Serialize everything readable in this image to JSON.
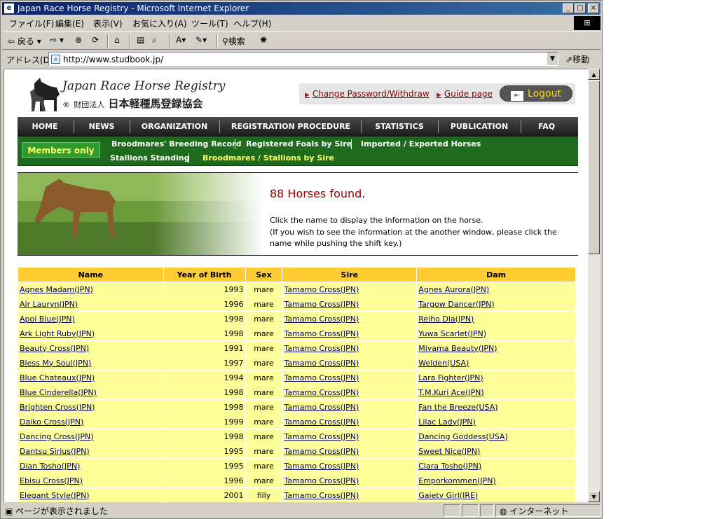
{
  "window": {
    "title": "Japan Race Horse Registry - Microsoft Internet Explorer",
    "controls": [
      "_",
      "□",
      "×"
    ]
  },
  "menu": [
    "ファイル(F)",
    "編集(E)",
    "表示(V)",
    "お気に入り(A)",
    "ツール(T)",
    "ヘルプ(H)"
  ],
  "toolbar": {
    "back": "戻る",
    "search": "検索"
  },
  "address": {
    "label": "アドレス(D)",
    "url": "http://www.studbook.jp/",
    "go": "移動"
  },
  "status": {
    "text": "ページが表示されました",
    "zone": "インターネット"
  },
  "site": {
    "logo_en": "Japan Race Horse Registry",
    "logo_jp_small": "財団法人",
    "logo_jp": "日本軽種馬登録協会",
    "links": {
      "change_password": "Change Password/Withdraw",
      "guide": "Guide page",
      "logout": "Logout"
    },
    "nav": [
      "HOME",
      "NEWS",
      "ORGANIZATION",
      "REGISTRATION PROCEDURE",
      "STATISTICS",
      "PUBLICATION",
      "FAQ"
    ],
    "members_only": "Members only",
    "subnav": {
      "row1": [
        "Broodmares' Breeding Record",
        "Registered Foals by Sire",
        "Imported / Exported Horses"
      ],
      "row2": [
        "Stallions Standing",
        "Broodmares / Stallions by Sire"
      ]
    },
    "found": "88 Horses found.",
    "instr1": "Click the name to display the information on the horse.",
    "instr2": "(If you wish to see the information at the another window, please click the name while pushing the shift key.)"
  },
  "table": {
    "headers": [
      "Name",
      "Year of Birth",
      "Sex",
      "Sire",
      "Dam"
    ],
    "rows": [
      [
        "Agnes Madam(JPN)",
        "1993",
        "mare",
        "Tamamo Cross(JPN)",
        "Agnes Aurora(JPN)"
      ],
      [
        "Air Lauryn(JPN)",
        "1996",
        "mare",
        "Tamamo Cross(JPN)",
        "Targow Dancer(JPN)"
      ],
      [
        "Apoi Blue(JPN)",
        "1998",
        "mare",
        "Tamamo Cross(JPN)",
        "Reiho Dia(JPN)"
      ],
      [
        "Ark Light Ruby(JPN)",
        "1998",
        "mare",
        "Tamamo Cross(JPN)",
        "Yuwa Scarlet(JPN)"
      ],
      [
        "Beauty Cross(JPN)",
        "1991",
        "mare",
        "Tamamo Cross(JPN)",
        "Miyama Beauty(JPN)"
      ],
      [
        "Bless My Soul(JPN)",
        "1997",
        "mare",
        "Tamamo Cross(JPN)",
        "Welden(USA)"
      ],
      [
        "Blue Chateaux(JPN)",
        "1994",
        "mare",
        "Tamamo Cross(JPN)",
        "Lara Fighter(JPN)"
      ],
      [
        "Blue Cinderella(JPN)",
        "1998",
        "mare",
        "Tamamo Cross(JPN)",
        "T.M.Kuri Ace(JPN)"
      ],
      [
        "Brighten Cross(JPN)",
        "1998",
        "mare",
        "Tamamo Cross(JPN)",
        "Fan the Breeze(USA)"
      ],
      [
        "Daiko Cross(JPN)",
        "1999",
        "mare",
        "Tamamo Cross(JPN)",
        "Lilac Lady(JPN)"
      ],
      [
        "Dancing Cross(JPN)",
        "1998",
        "mare",
        "Tamamo Cross(JPN)",
        "Dancing Goddess(USA)"
      ],
      [
        "Dantsu Sirius(JPN)",
        "1995",
        "mare",
        "Tamamo Cross(JPN)",
        "Sweet Nice(JPN)"
      ],
      [
        "Dian Tosho(JPN)",
        "1995",
        "mare",
        "Tamamo Cross(JPN)",
        "Clara Tosho(JPN)"
      ],
      [
        "Ebisu Cross(JPN)",
        "1996",
        "mare",
        "Tamamo Cross(JPN)",
        "Emporkommen(JPN)"
      ],
      [
        "Elegant Style(JPN)",
        "2001",
        "filly",
        "Tamamo Cross(JPN)",
        "Gaiety Girl(IRE)"
      ]
    ]
  }
}
